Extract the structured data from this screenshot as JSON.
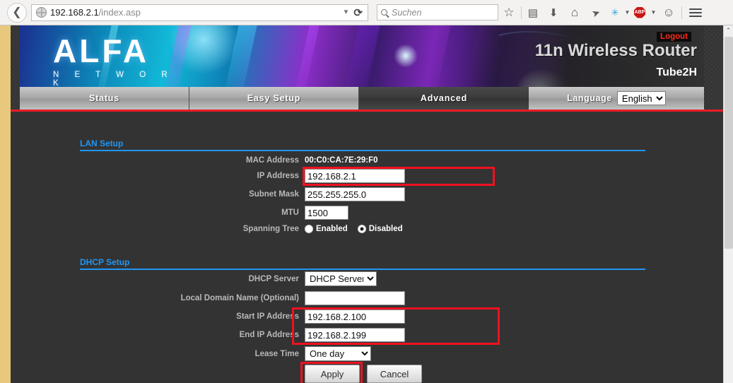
{
  "browser": {
    "back_icon": "back-arrow-icon",
    "site_icon": "globe-icon",
    "url_host": "192.168.2.1",
    "url_path": "/index.asp",
    "url_dropdown_icon": "▼",
    "reload_icon": "⟳",
    "search_placeholder": "Suchen",
    "search_icon": "search-icon",
    "toolbar_icons": [
      {
        "name": "bookmark-star-icon",
        "glyph": "☆"
      },
      {
        "name": "reader-list-icon",
        "glyph": "▤"
      },
      {
        "name": "downloads-icon",
        "glyph": "⬇"
      },
      {
        "name": "home-icon",
        "glyph": "⌂"
      },
      {
        "name": "send-tab-icon",
        "glyph": "➤"
      },
      {
        "name": "noscript-icon",
        "glyph": "✳"
      },
      {
        "name": "adblock-plus-icon",
        "glyph": "ABP"
      },
      {
        "name": "feedback-smiley-icon",
        "glyph": "☺"
      },
      {
        "name": "menu-hamburger-icon",
        "glyph": "☰"
      }
    ]
  },
  "header": {
    "logo_wordmark": "ALFA",
    "logo_subtitle": "N E T W O R K",
    "logout_label": "Logout",
    "product_title": "11n Wireless Router",
    "model_name": "Tube2H"
  },
  "nav": {
    "tabs": [
      {
        "label": "Status",
        "active": false
      },
      {
        "label": "Easy Setup",
        "active": false
      },
      {
        "label": "Advanced",
        "active": true
      }
    ],
    "language_label": "Language",
    "language_selected": "English",
    "language_options": [
      "English"
    ]
  },
  "lan_setup": {
    "section_title": "LAN Setup",
    "mac_address_label": "MAC Address",
    "mac_address_value": "00:C0:CA:7E:29:F0",
    "ip_address_label": "IP Address",
    "ip_address_value": "192.168.2.1",
    "subnet_mask_label": "Subnet Mask",
    "subnet_mask_value": "255.255.255.0",
    "mtu_label": "MTU",
    "mtu_value": "1500",
    "spanning_tree_label": "Spanning Tree",
    "spanning_tree_enabled_label": "Enabled",
    "spanning_tree_disabled_label": "Disabled",
    "spanning_tree_selected": "Disabled"
  },
  "dhcp_setup": {
    "section_title": "DHCP Setup",
    "dhcp_server_label": "DHCP Server",
    "dhcp_server_selected": "DHCP Server",
    "dhcp_server_options": [
      "DHCP Server"
    ],
    "local_domain_label": "Local Domain Name (Optional)",
    "local_domain_value": "",
    "start_ip_label": "Start IP Address",
    "start_ip_value": "192.168.2.100",
    "end_ip_label": "End IP Address",
    "end_ip_value": "192.168.2.199",
    "lease_time_label": "Lease Time",
    "lease_time_selected": "One day",
    "lease_time_options": [
      "One day"
    ]
  },
  "actions": {
    "apply_label": "Apply",
    "cancel_label": "Cancel"
  },
  "colors": {
    "accent_red": "#e81c2a",
    "highlight_red": "#f01120",
    "section_blue": "#2196f3",
    "page_bg": "#333333",
    "logout_red": "#ff2a1a"
  },
  "scrollbar": {
    "up_arrow": "⌃"
  }
}
